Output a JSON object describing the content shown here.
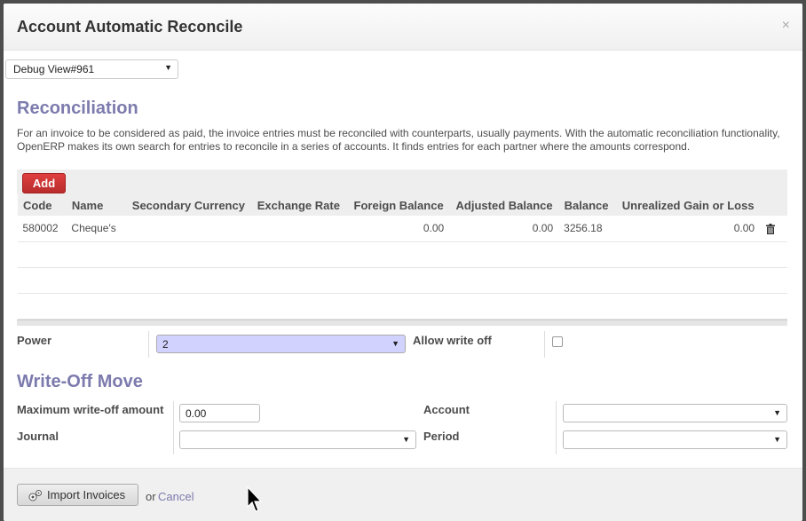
{
  "dialog": {
    "title": "Account Automatic Reconcile",
    "close_glyph": "×"
  },
  "debug": {
    "value": "Debug View#961",
    "arrow": "▼"
  },
  "reconciliation": {
    "title": "Reconciliation",
    "help": "For an invoice to be considered as paid, the invoice entries must be reconciled with counterparts, usually payments. With the automatic reconciliation functionality, OpenERP makes its own search for entries to reconcile in a series of accounts. It finds entries for each partner where the amounts correspond."
  },
  "grid": {
    "add_label": "Add",
    "columns": [
      "Code",
      "Name",
      "Secondary Currency",
      "Exchange Rate",
      "Foreign Balance",
      "Adjusted Balance",
      "Balance",
      "Unrealized Gain or Loss"
    ],
    "rows": [
      {
        "code": "580002",
        "name": "Cheque's",
        "secondary_currency": "",
        "exchange_rate": "",
        "foreign_balance": "0.00",
        "adjusted_balance": "0.00",
        "balance": "3256.18",
        "unrealized": "0.00"
      }
    ]
  },
  "power": {
    "label": "Power",
    "value": "2"
  },
  "allow_write_off": {
    "label": "Allow write off",
    "checked": false
  },
  "write_off": {
    "title": "Write-Off Move",
    "max_amount_label": "Maximum write-off amount",
    "max_amount_value": "0.00",
    "journal_label": "Journal",
    "journal_value": "",
    "account_label": "Account",
    "account_value": "",
    "period_label": "Period",
    "period_value": ""
  },
  "footer": {
    "import_label": "Import Invoices",
    "or_text": "or",
    "cancel_label": "Cancel"
  },
  "colors": {
    "accent": "#7c7bad",
    "add_button": "#c0302f",
    "power_field": "#d2d2ff"
  },
  "icons": {
    "trash": "trash-icon",
    "import": "import-icon",
    "cursor": "mouse-cursor"
  }
}
